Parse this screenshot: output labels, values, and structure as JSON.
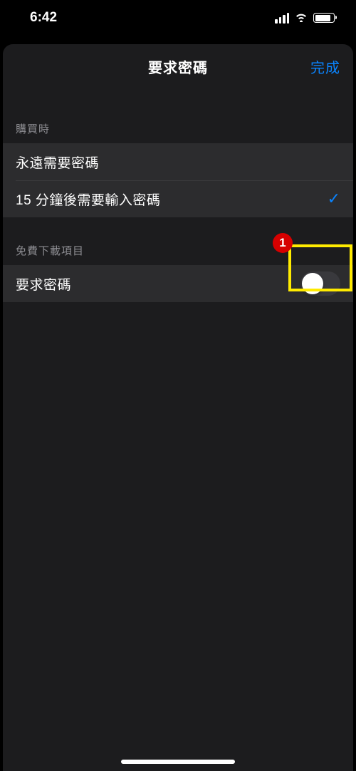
{
  "status": {
    "time": "6:42"
  },
  "nav": {
    "title": "要求密碼",
    "done": "完成"
  },
  "section1": {
    "header": "購買時",
    "options": [
      {
        "label": "永遠需要密碼",
        "selected": false
      },
      {
        "label": "15 分鐘後需要輸入密碼",
        "selected": true
      }
    ]
  },
  "section2": {
    "header": "免費下載項目",
    "toggle_label": "要求密碼",
    "toggle_on": false
  },
  "annotation": {
    "badge": "1"
  }
}
